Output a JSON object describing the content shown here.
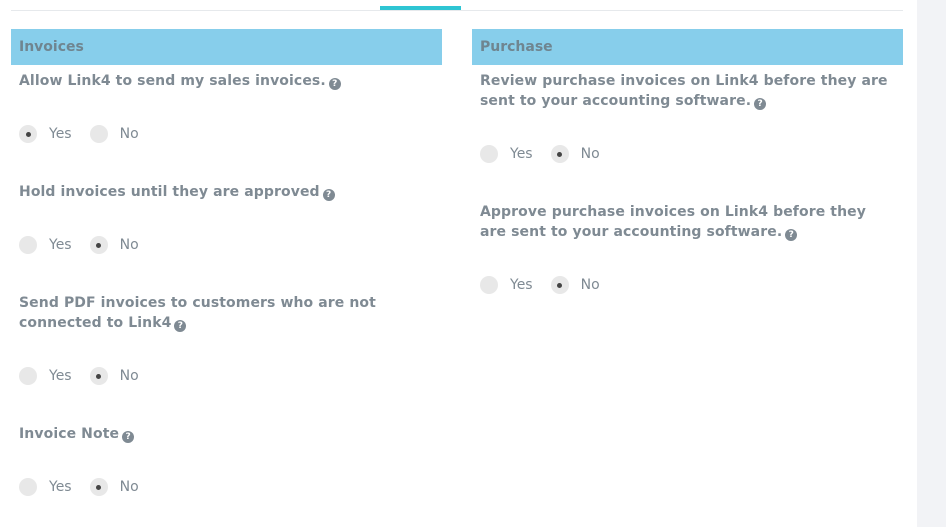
{
  "invoices": {
    "title": "Invoices",
    "settings": [
      {
        "label": "Allow Link4 to send my sales invoices.",
        "yes": "Yes",
        "no": "No",
        "selected": "Yes"
      },
      {
        "label": "Hold invoices until they are approved",
        "yes": "Yes",
        "no": "No",
        "selected": "No"
      },
      {
        "label": "Send PDF invoices to customers who are not connected to Link4",
        "yes": "Yes",
        "no": "No",
        "selected": "No"
      },
      {
        "label": "Invoice Note",
        "yes": "Yes",
        "no": "No",
        "selected": "No"
      }
    ]
  },
  "purchase": {
    "title": "Purchase",
    "settings": [
      {
        "label": "Review purchase invoices on Link4 before they are sent to your accounting software.",
        "yes": "Yes",
        "no": "No",
        "selected": "No"
      },
      {
        "label": "Approve purchase invoices on Link4 before they are sent to your accounting software.",
        "yes": "Yes",
        "no": "No",
        "selected": "No"
      }
    ]
  },
  "help_icon": "question-circle-icon",
  "colors": {
    "section_header_bg": "#87ceeb",
    "tab_indicator": "#2ec5d3",
    "text": "#7f8a93"
  }
}
